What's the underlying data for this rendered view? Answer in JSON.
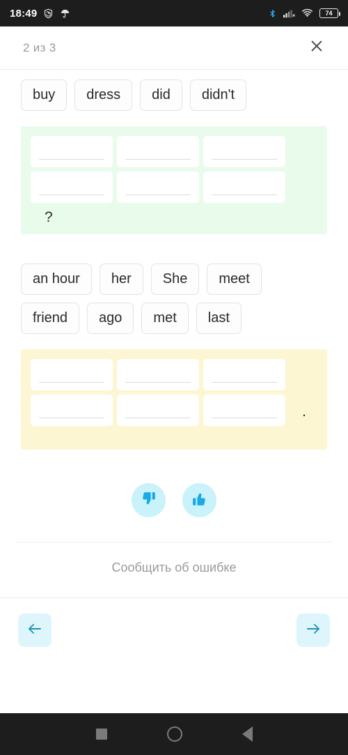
{
  "status_bar": {
    "time": "18:49",
    "left_icons": [
      "do-not-disturb-icon",
      "umbrella-icon"
    ],
    "right_icons": [
      "bluetooth-icon",
      "cellular-signal-icon",
      "wifi-icon"
    ],
    "battery_percent": "74",
    "background_color": "#1d1d1d",
    "bluetooth_color": "#29b6f6"
  },
  "header": {
    "counter": "2 из 3",
    "close_icon": "close-icon"
  },
  "exercise": {
    "tasks": [
      {
        "word_bank": [
          "buy",
          "dress",
          "did",
          "didn't"
        ],
        "zone_color": "#e9fbeb",
        "zone_name": "green",
        "slot_count": 6,
        "trailing_punctuation": "?"
      },
      {
        "word_bank": [
          "an hour",
          "her",
          "She",
          "meet",
          "friend",
          "ago",
          "met",
          "last"
        ],
        "zone_color": "#fdf6d2",
        "zone_name": "yellow",
        "slot_count": 6,
        "trailing_punctuation": "."
      }
    ]
  },
  "feedback": {
    "dislike_icon": "thumbs-down-icon",
    "like_icon": "thumbs-up-icon",
    "button_background": "#c9f2fa",
    "icon_color": "#18a9e8"
  },
  "report": {
    "label": "Сообщить об ошибке"
  },
  "navigation": {
    "prev_icon": "arrow-left-icon",
    "next_icon": "arrow-right-icon",
    "button_background": "#ddf5fb",
    "arrow_color": "#1f93b5"
  },
  "system_nav": {
    "recents_icon": "square-recents-icon",
    "home_icon": "circle-home-icon",
    "back_icon": "triangle-back-icon"
  }
}
